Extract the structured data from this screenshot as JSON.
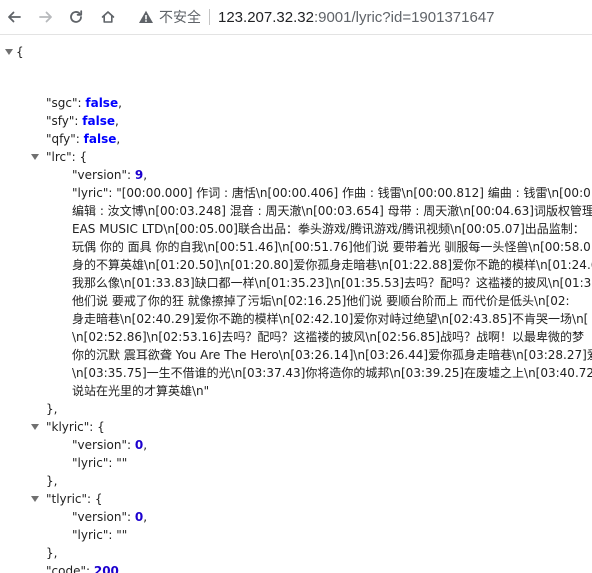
{
  "browser": {
    "security_label": "不安全",
    "url_host": "123.207.32.32",
    "url_rest": ":9001/lyric?id=1901371647"
  },
  "json": {
    "open_brace": "{",
    "close_brace": "}",
    "sgc": {
      "key": "\"sgc\"",
      "value": "false"
    },
    "sfy": {
      "key": "\"sfy\"",
      "value": "false"
    },
    "qfy": {
      "key": "\"qfy\"",
      "value": "false"
    },
    "lrc": {
      "key": "\"lrc\"",
      "version_key": "\"version\"",
      "version_value": "9",
      "lyric_key": "\"lyric\"",
      "lyric_lines": [
        "\"[00:00.000] 作词 : 唐恬\\n[00:00.406] 作曲 : 钱雷\\n[00:00.812] 编曲 : 钱雷\\n[00:01.2",
        "编辑 : 汝文博\\n[00:03.248] 混音 : 周天澈\\n[00:03.654] 母带 : 周天澈\\n[00:04.63]词版权管理",
        "EAS MUSIC LTD\\n[00:05.00]联合出品：拳头游戏/腾讯游戏/腾讯视频\\n[00:05.07]出品监制：",
        "玩偶 你的 面具 你的自我\\n[00:51.46]\\n[00:51.76]他们说 要带着光 驯服每一头怪兽\\n[00:58.0",
        "身的不算英雄\\n[01:20.50]\\n[01:20.80]爱你孤身走暗巷\\n[01:22.88]爱你不跪的模样\\n[01:24.6",
        "我那么像\\n[01:33.83]缺口都一样\\n[01:35.23]\\n[01:35.53]去吗？配吗？这褴褛的披风\\n[01:3",
        "他们说 要戒了你的狂 就像擦掉了污垢\\n[02:16.25]他们说 要顺台阶而上 而代价是低头\\n[02:",
        "身走暗巷\\n[02:40.29]爱你不跪的模样\\n[02:42.10]爱你对峙过绝望\\n[02:43.85]不肯哭一场\\n[",
        "\\n[02:52.86]\\n[02:53.16]去吗？配吗？这褴褛的披风\\n[02:56.85]战吗？战啊！以最卑微的梦",
        "你的沉默 震耳欲聋 You Are The Hero\\n[03:26.14]\\n[03:26.44]爱你孤身走暗巷\\n[03:28.27]爱",
        "\\n[03:35.75]一生不借谁的光\\n[03:37.43]你将造你的城邦\\n[03:39.25]在废墟之上\\n[03:40.72]",
        "说站在光里的才算英雄\\n\""
      ]
    },
    "klyric": {
      "key": "\"klyric\"",
      "version_key": "\"version\"",
      "version_value": "0",
      "lyric_key": "\"lyric\"",
      "lyric_value": "\"\""
    },
    "tlyric": {
      "key": "\"tlyric\"",
      "version_key": "\"version\"",
      "version_value": "0",
      "lyric_key": "\"lyric\"",
      "lyric_value": "\"\""
    },
    "code": {
      "key": "\"code\"",
      "value": "200"
    }
  }
}
